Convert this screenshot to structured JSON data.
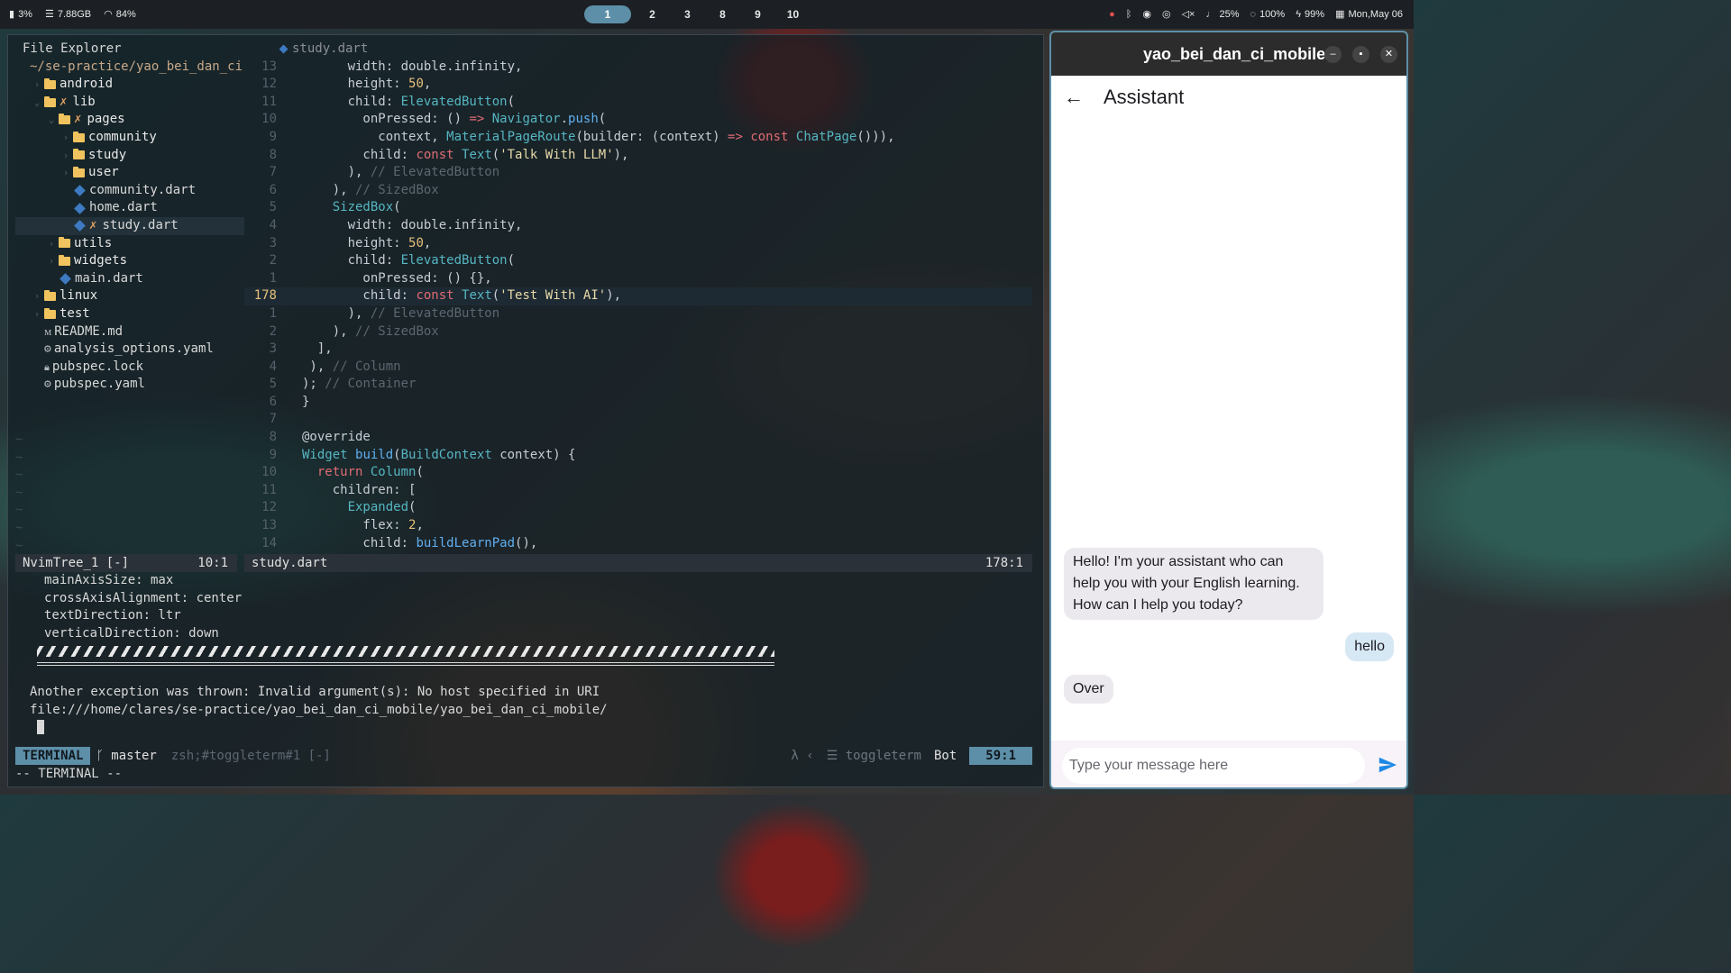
{
  "topbar": {
    "cpu": "3%",
    "mem": "7.88GB",
    "wifi": "84%",
    "workspaces": [
      "1",
      "2",
      "3",
      "8",
      "9",
      "10"
    ],
    "volume": "",
    "mic": "25%",
    "brightness": "100%",
    "battery": "99%",
    "date": "Mon,May 06"
  },
  "tree": {
    "title": "File Explorer",
    "root": "~/se-practice/yao_bei_dan_ci",
    "items": [
      {
        "name": "android",
        "kind": "dir",
        "depth": 1,
        "chev": "›"
      },
      {
        "name": "lib",
        "kind": "dir",
        "depth": 1,
        "chev": "⌄",
        "mod": "✗"
      },
      {
        "name": "pages",
        "kind": "dir",
        "depth": 2,
        "chev": "⌄",
        "mod": "✗"
      },
      {
        "name": "community",
        "kind": "dir",
        "depth": 3,
        "chev": "›"
      },
      {
        "name": "study",
        "kind": "dir",
        "depth": 3,
        "chev": "›"
      },
      {
        "name": "user",
        "kind": "dir",
        "depth": 3,
        "chev": "›"
      },
      {
        "name": "community.dart",
        "kind": "dart",
        "depth": 3
      },
      {
        "name": "home.dart",
        "kind": "dart",
        "depth": 3
      },
      {
        "name": "study.dart",
        "kind": "dart",
        "depth": 3,
        "mod": "✗",
        "selected": true
      },
      {
        "name": "utils",
        "kind": "dir",
        "depth": 2,
        "chev": "›"
      },
      {
        "name": "widgets",
        "kind": "dir",
        "depth": 2,
        "chev": "›"
      },
      {
        "name": "main.dart",
        "kind": "dart",
        "depth": 2
      },
      {
        "name": "linux",
        "kind": "dir",
        "depth": 1,
        "chev": "›"
      },
      {
        "name": "test",
        "kind": "dir",
        "depth": 1,
        "chev": "›"
      },
      {
        "name": "README.md",
        "kind": "md",
        "depth": 1
      },
      {
        "name": "analysis_options.yaml",
        "kind": "gear",
        "depth": 1
      },
      {
        "name": "pubspec.lock",
        "kind": "lock",
        "depth": 1
      },
      {
        "name": "pubspec.yaml",
        "kind": "gear",
        "depth": 1
      }
    ]
  },
  "editor": {
    "tab": "study.dart",
    "lines": [
      {
        "n": "13",
        "h": "      width: double.infinity,"
      },
      {
        "n": "12",
        "h": "      height: <span class=\"num\">50</span>,"
      },
      {
        "n": "11",
        "h": "      child: <span class=\"ty\">ElevatedButton</span>("
      },
      {
        "n": "10",
        "h": "        onPressed: () <span class=\"kw\">=></span> <span class=\"ty\">Navigator</span>.<span class=\"fn\">push</span>("
      },
      {
        "n": "9",
        "h": "          context, <span class=\"ty\">MaterialPageRoute</span>(builder: (context) <span class=\"kw\">=></span> <span class=\"kw\">const</span> <span class=\"ty\">ChatPage</span>())),"
      },
      {
        "n": "8",
        "h": "        child: <span class=\"kw\">const</span> <span class=\"ty\">Text</span>(<span class=\"str\">'Talk With LLM'</span>),"
      },
      {
        "n": "7",
        "h": "      ), <span class=\"cm\">// ElevatedButton</span>"
      },
      {
        "n": "6",
        "h": "    ), <span class=\"cm\">// SizedBox</span>"
      },
      {
        "n": "5",
        "h": "    <span class=\"ty\">SizedBox</span>("
      },
      {
        "n": "4",
        "h": "      width: double.infinity,"
      },
      {
        "n": "3",
        "h": "      height: <span class=\"num\">50</span>,"
      },
      {
        "n": "2",
        "h": "      child: <span class=\"ty\">ElevatedButton</span>("
      },
      {
        "n": "1",
        "h": "        onPressed: () {},"
      },
      {
        "n": "178",
        "h": "        child: <span class=\"kw\">const</span> <span class=\"ty\">Text</span>(<span class=\"str\">'Test With AI'</span>),",
        "cur": true
      },
      {
        "n": "1",
        "h": "      ), <span class=\"cm\">// ElevatedButton</span>"
      },
      {
        "n": "2",
        "h": "    ), <span class=\"cm\">// SizedBox</span>"
      },
      {
        "n": "3",
        "h": "  ],"
      },
      {
        "n": "4",
        "h": " ), <span class=\"cm\">// Column</span>"
      },
      {
        "n": "5",
        "h": "); <span class=\"cm\">// Container</span>"
      },
      {
        "n": "6",
        "h": "}"
      },
      {
        "n": "7",
        "h": ""
      },
      {
        "n": "8",
        "h": "@override"
      },
      {
        "n": "9",
        "h": "<span class=\"ty\">Widget</span> <span class=\"fn\">build</span>(<span class=\"ty\">BuildContext</span> context) {"
      },
      {
        "n": "10",
        "h": "  <span class=\"kw\">return</span> <span class=\"ty\">Column</span>("
      },
      {
        "n": "11",
        "h": "    children: ["
      },
      {
        "n": "12",
        "h": "      <span class=\"ty\">Expanded</span>("
      },
      {
        "n": "13",
        "h": "        flex: <span class=\"num\">2</span>,"
      },
      {
        "n": "14",
        "h": "        child: <span class=\"fn\">buildLearnPad</span>(),"
      }
    ]
  },
  "status1": {
    "left_name": "NvimTree_1 [-]",
    "left_pos": "10:1",
    "right_name": "study.dart",
    "right_pos": "178:1"
  },
  "terminal": {
    "props": [
      "mainAxisSize: max",
      "crossAxisAlignment: center",
      "textDirection: ltr",
      "verticalDirection: down"
    ],
    "error1": "Another exception was thrown: Invalid argument(s): No host specified in URI",
    "error2": "file:///home/clares/se-practice/yao_bei_dan_ci_mobile/yao_bei_dan_ci_mobile/"
  },
  "status2": {
    "mode": "TERMINAL",
    "branch": "master",
    "cmd": "zsh;#toggleterm#1 [-]",
    "filetype": "toggleterm",
    "scroll": "Bot",
    "pos": "59:1"
  },
  "modeline": "-- TERMINAL --",
  "app": {
    "window_title": "yao_bei_dan_ci_mobile",
    "appbar_title": "Assistant",
    "messages": [
      {
        "from": "assistant",
        "text": "Hello! I'm your assistant who can help you with your English learning. How can I help you today?"
      },
      {
        "from": "user",
        "text": "hello"
      },
      {
        "from": "assistant",
        "text": "Over"
      }
    ],
    "input_placeholder": "Type your message here",
    "accent": "#1e88e5"
  }
}
